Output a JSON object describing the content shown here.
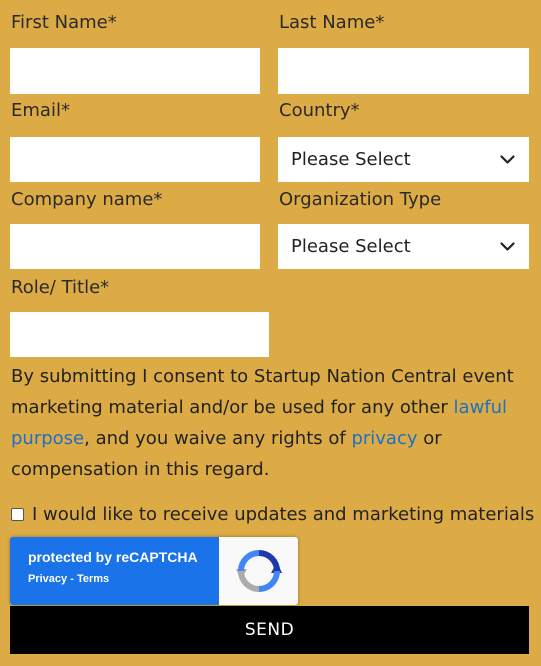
{
  "form": {
    "first_name": {
      "label": "First Name*",
      "value": ""
    },
    "last_name": {
      "label": "Last Name*",
      "value": ""
    },
    "email": {
      "label": "Email*",
      "value": ""
    },
    "country": {
      "label": "Country*",
      "selected": "Please Select"
    },
    "company": {
      "label": "Company name*",
      "value": ""
    },
    "org_type": {
      "label": "Organization Type",
      "selected": "Please Select"
    },
    "role": {
      "label": "Role/ Title*",
      "value": ""
    },
    "consent": {
      "part1": "By submitting I consent to Startup Nation Central event marketing material and/or be used for any other ",
      "link1": "lawful purpose",
      "part2": ", and you waive any rights of ",
      "link2": "privacy",
      "part3": " or compensation in this regard."
    },
    "updates_checkbox": {
      "label": "I would like to receive updates and marketing materials",
      "checked": false
    },
    "recaptcha": {
      "title": "protected by reCAPTCHA",
      "privacy": "Privacy",
      "sep": " - ",
      "terms": "Terms"
    },
    "submit_label": "SEND"
  },
  "colors": {
    "background": "#dcab45",
    "link": "#1f6fc4",
    "button": "#000000",
    "recaptcha_blue": "#1a73e8"
  }
}
